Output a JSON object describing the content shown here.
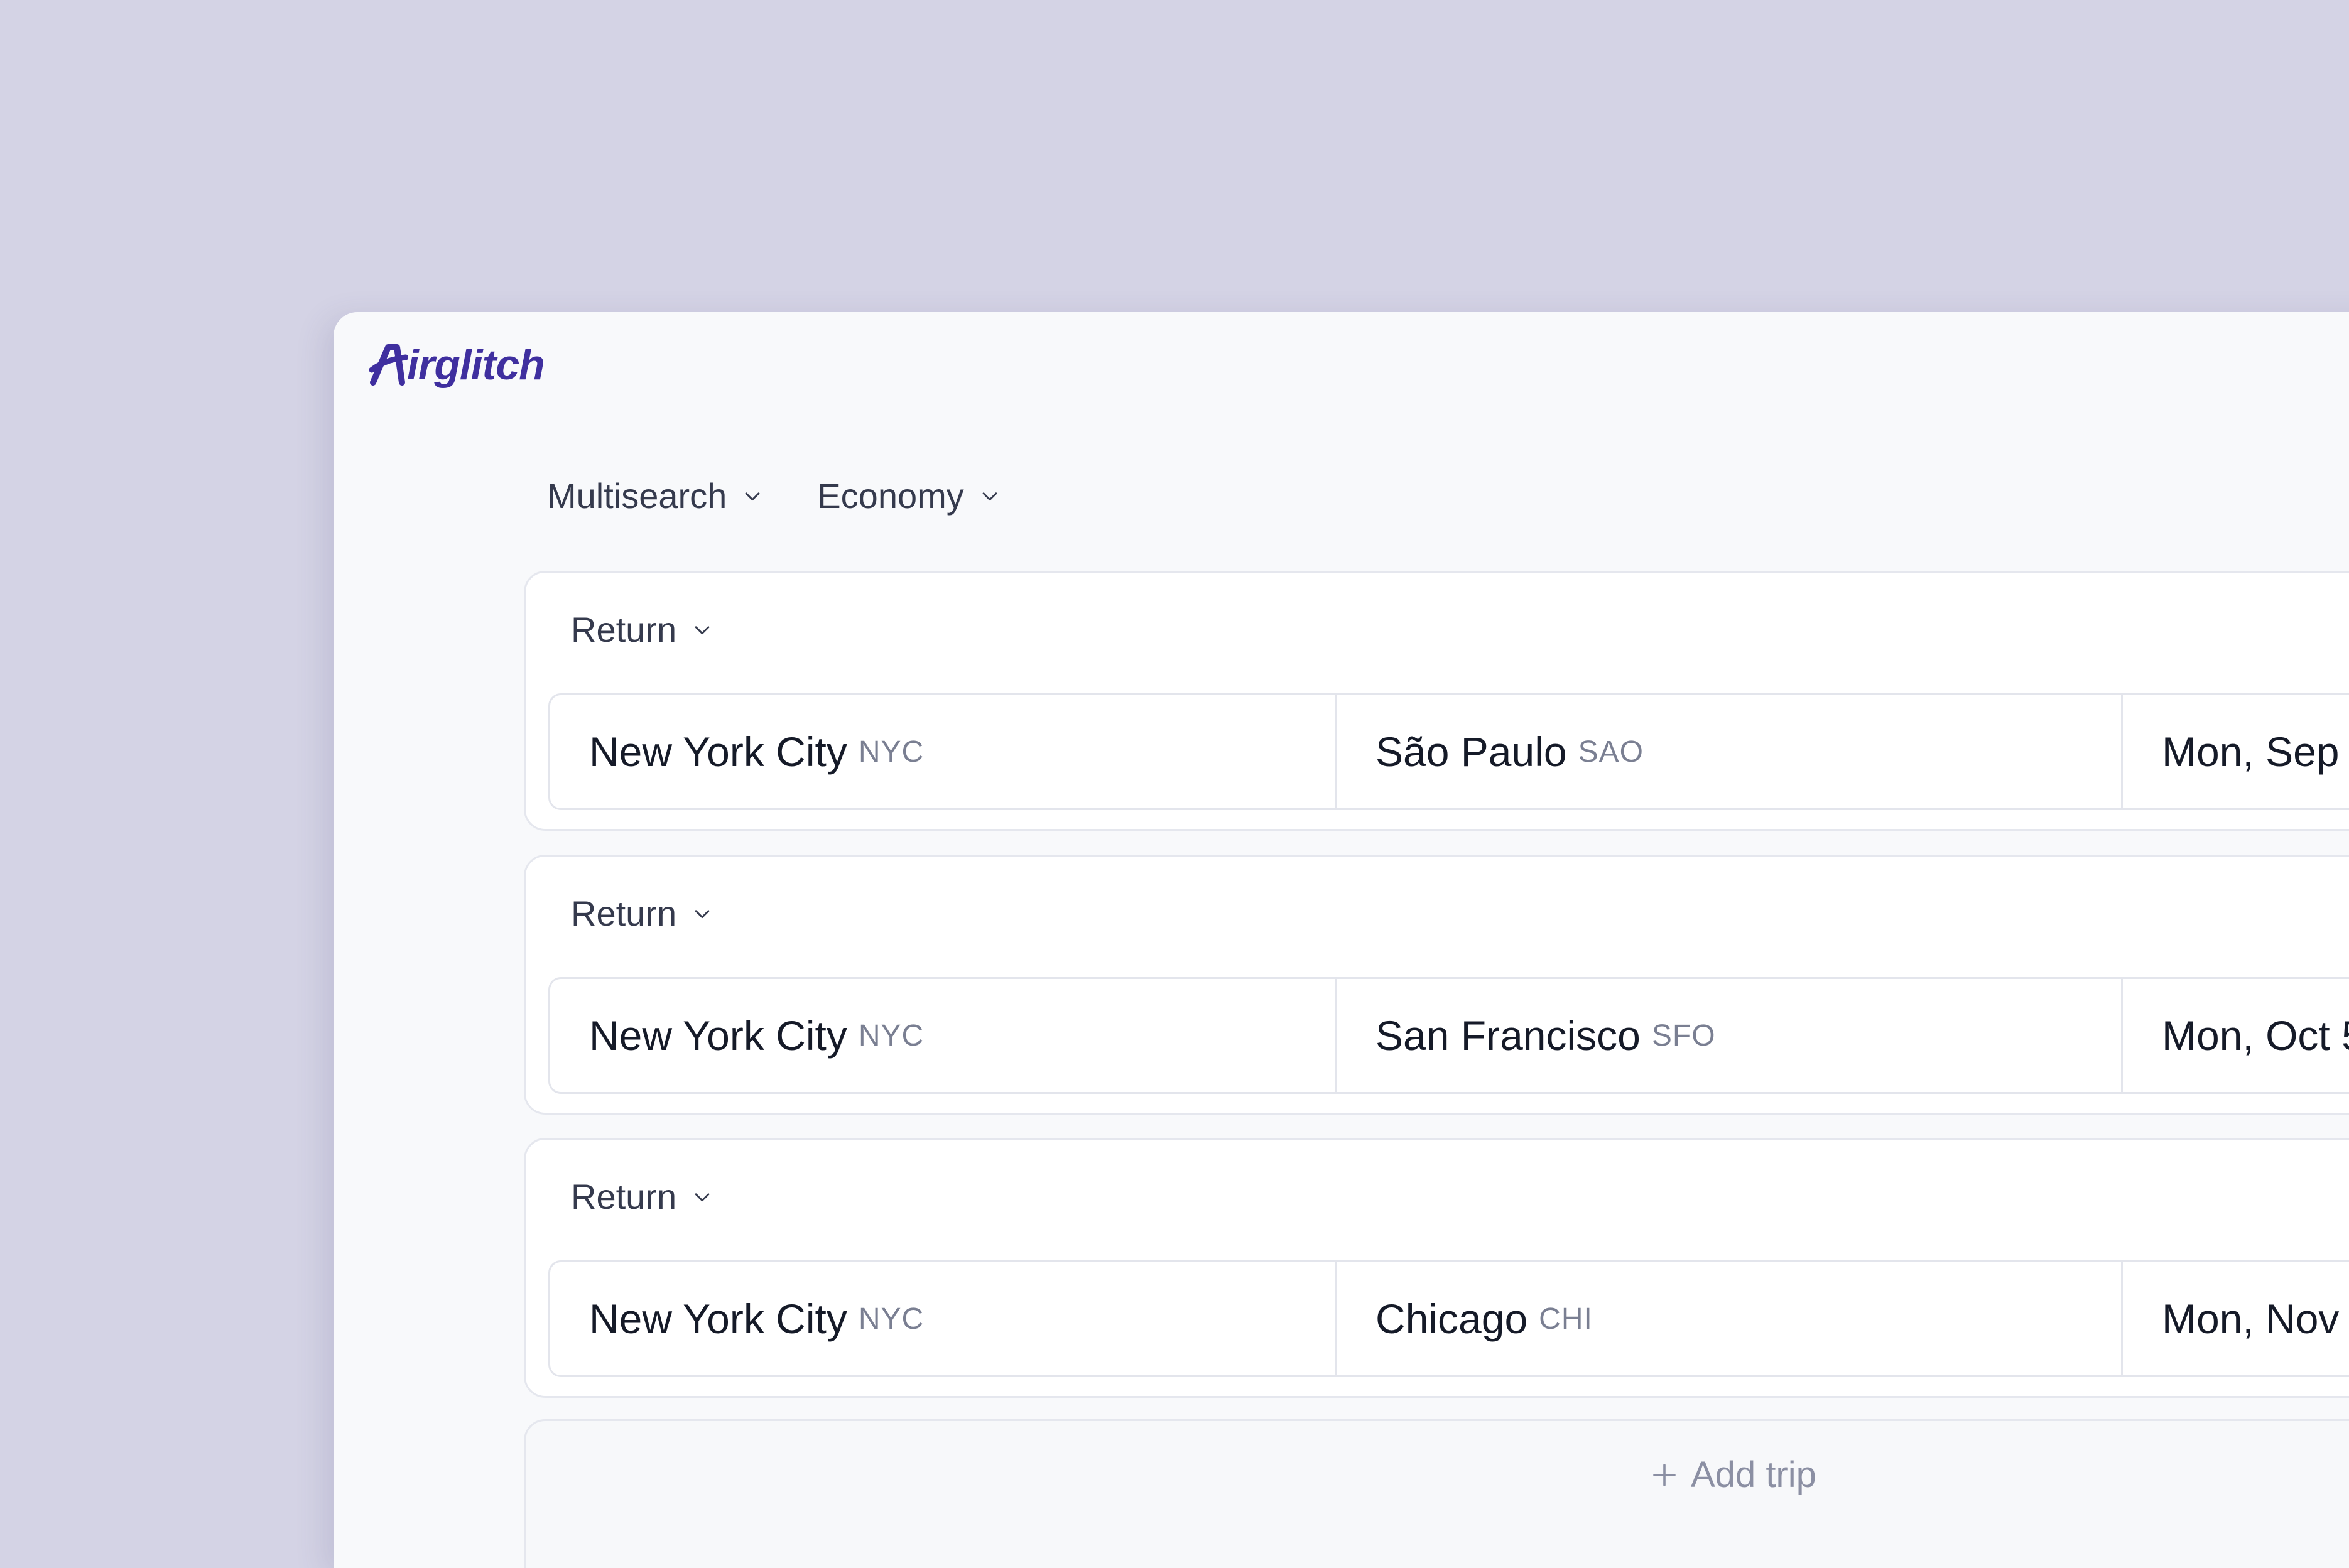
{
  "app": {
    "logo_text": "irglitch",
    "brand_color": "#3f2f9f"
  },
  "search_options": {
    "mode": "Multisearch",
    "cabin_class": "Economy"
  },
  "trips": [
    {
      "type": "Return",
      "origin": {
        "city": "New York City",
        "code": "NYC"
      },
      "destination": {
        "city": "São Paulo",
        "code": "SAO"
      },
      "date": "Mon, Sep"
    },
    {
      "type": "Return",
      "origin": {
        "city": "New York City",
        "code": "NYC"
      },
      "destination": {
        "city": "San Francisco",
        "code": "SFO"
      },
      "date": "Mon, Oct 5"
    },
    {
      "type": "Return",
      "origin": {
        "city": "New York City",
        "code": "NYC"
      },
      "destination": {
        "city": "Chicago",
        "code": "CHI"
      },
      "date": "Mon, Nov"
    }
  ],
  "add_trip": {
    "label": "Add trip",
    "icon": "plus-icon"
  },
  "icons": {
    "dropdown": "chevron-down-icon"
  }
}
